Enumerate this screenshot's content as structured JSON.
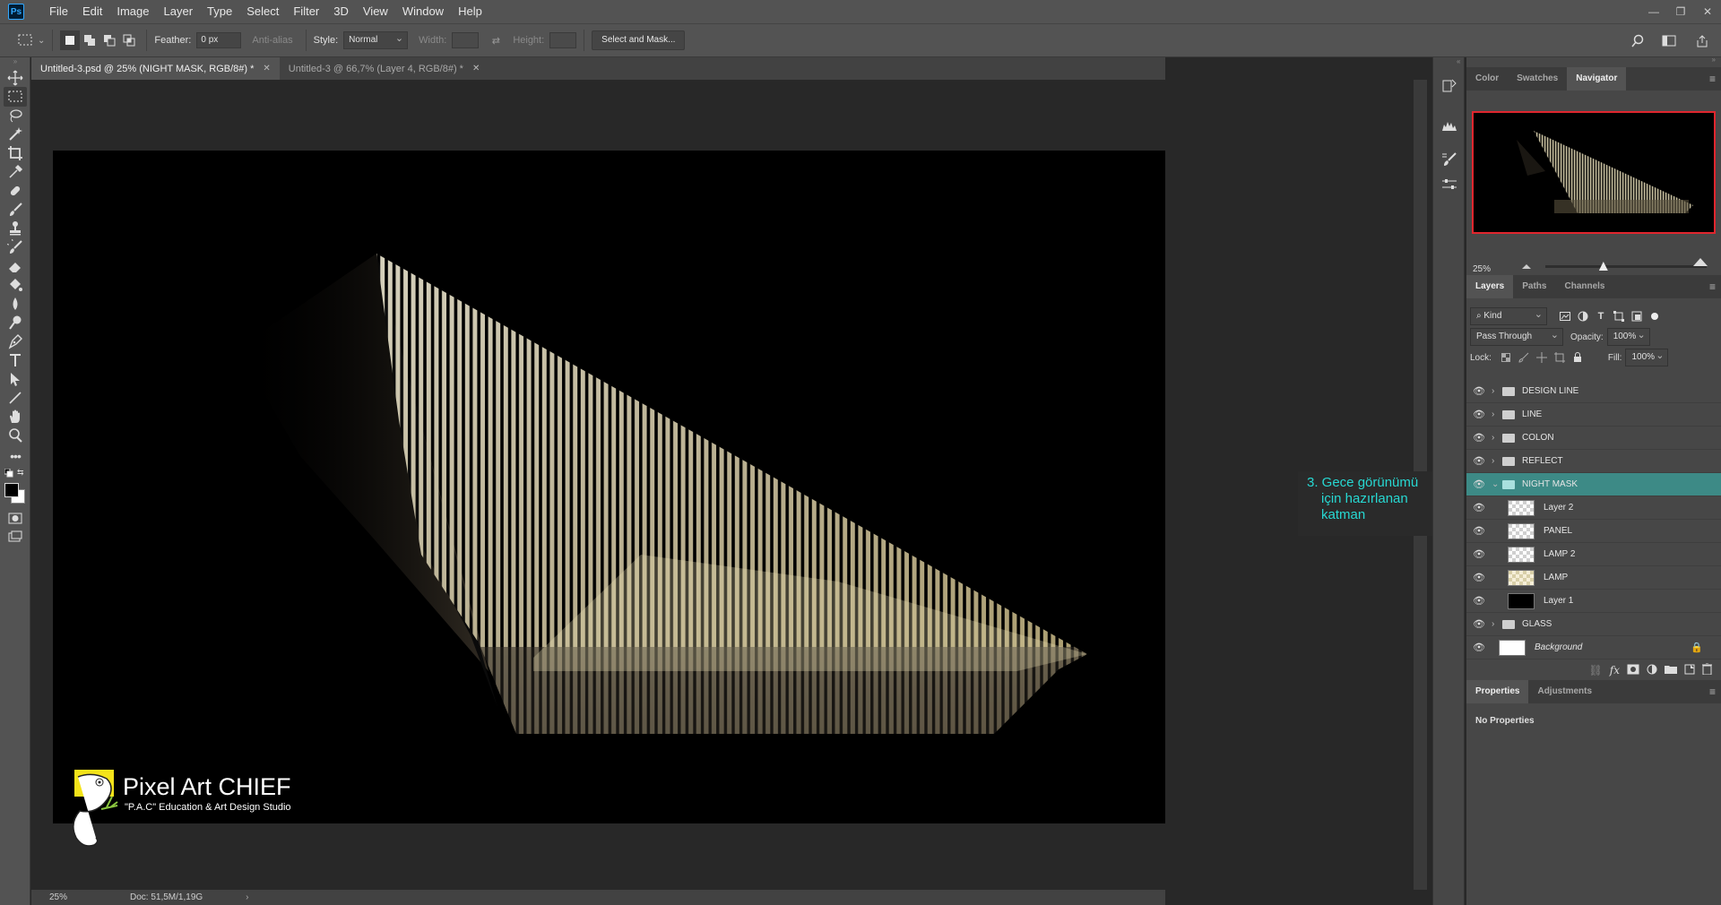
{
  "app": {
    "logo": "Ps"
  },
  "menu": [
    "File",
    "Edit",
    "Image",
    "Layer",
    "Type",
    "Select",
    "Filter",
    "3D",
    "View",
    "Window",
    "Help"
  ],
  "options": {
    "feather_label": "Feather:",
    "feather_value": "0 px",
    "antialias_label": "Anti-alias",
    "style_label": "Style:",
    "style_value": "Normal",
    "width_label": "Width:",
    "height_label": "Height:",
    "select_mask_label": "Select and Mask..."
  },
  "tabs": [
    {
      "label": "Untitled-3.psd @ 25% (NIGHT MASK, RGB/8#) *",
      "active": true
    },
    {
      "label": "Untitled-3 @ 66,7% (Layer 4, RGB/8#) *",
      "active": false
    }
  ],
  "watermark": {
    "title": "Pixel Art CHIEF",
    "subtitle": "\"P.A.C\" Education & Art Design Studio"
  },
  "annotation": {
    "line1": "3. Gece görünümü",
    "line2": "için hazırlanan",
    "line3": "katman"
  },
  "status": {
    "zoom": "25%",
    "doc": "Doc: 51,5M/1,19G",
    "arrow": "›"
  },
  "navigator": {
    "tabs": [
      "Color",
      "Swatches",
      "Navigator"
    ],
    "zoom": "25%",
    "zoom_fraction": 0.36
  },
  "layers_panel": {
    "tabs": [
      "Layers",
      "Paths",
      "Channels"
    ],
    "kind": "Kind",
    "blend": "Pass Through",
    "opacity_label": "Opacity:",
    "opacity": "100%",
    "lock_label": "Lock:",
    "fill_label": "Fill:",
    "fill": "100%"
  },
  "layers": [
    {
      "name": "DESIGN LINE",
      "type": "group"
    },
    {
      "name": "LINE",
      "type": "group"
    },
    {
      "name": "COLON",
      "type": "group"
    },
    {
      "name": "REFLECT",
      "type": "group"
    },
    {
      "name": "NIGHT MASK",
      "type": "group-open"
    },
    {
      "name": "Layer 2",
      "type": "layer",
      "thumb": "checker"
    },
    {
      "name": "PANEL",
      "type": "layer",
      "thumb": "checker"
    },
    {
      "name": "LAMP 2",
      "type": "layer",
      "thumb": "checker"
    },
    {
      "name": "LAMP",
      "type": "layer",
      "thumb": "checker-y"
    },
    {
      "name": "Layer 1",
      "type": "layer",
      "thumb": "black"
    },
    {
      "name": "GLASS",
      "type": "group"
    },
    {
      "name": "Background",
      "type": "background"
    }
  ],
  "properties": {
    "tabs": [
      "Properties",
      "Adjustments"
    ],
    "empty": "No Properties"
  },
  "colors": {
    "selection": "#3d8a86",
    "annotation": "#27d8d2",
    "navigator_frame": "#e0262e",
    "logo_yellow": "#f4e31a"
  }
}
